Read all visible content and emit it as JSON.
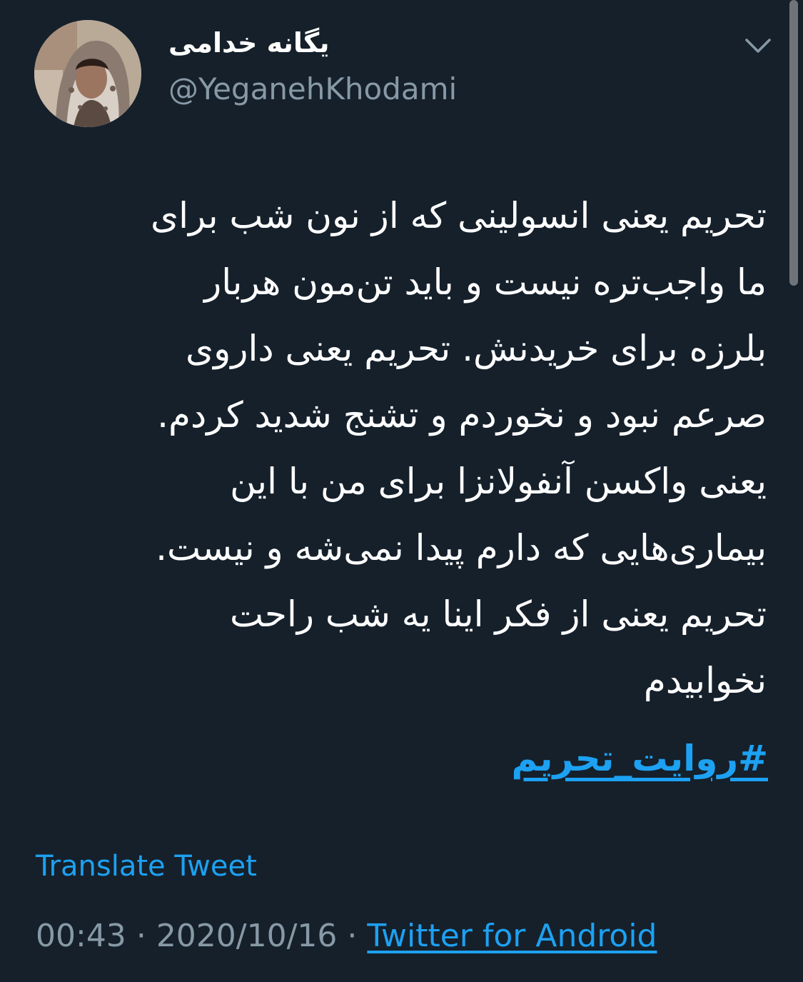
{
  "author": {
    "display_name": "یگانه خدامی",
    "handle": "@YeganehKhodami",
    "avatar_icon": "profile-photo"
  },
  "tweet": {
    "text_lines": [
      "تحریم یعنی انسولینی که از نون شب برای",
      "ما واجب‌تره نیست و باید تن‌مون هربار",
      "بلرزه برای خریدنش. تحریم یعنی داروی",
      "صرعم نبود و نخوردم و تشنج شدید کردم.",
      "یعنی واکسن آنفولانزا برای من با این",
      "بیماری‌هایی که دارم پیدا نمی‌شه و نیست.",
      "تحریم یعنی از فکر اینا یه شب راحت",
      "نخوابیدم"
    ],
    "hashtag": "#روایت_تحریم"
  },
  "actions": {
    "translate_label": "Translate Tweet",
    "menu_icon": "chevron-down-icon"
  },
  "meta": {
    "time": "00:43",
    "separator": "·",
    "date": "2020/10/16",
    "source": "Twitter for Android"
  },
  "colors": {
    "background": "#15202b",
    "text": "#ffffff",
    "secondary": "#8899a6",
    "accent": "#1da1f2"
  }
}
